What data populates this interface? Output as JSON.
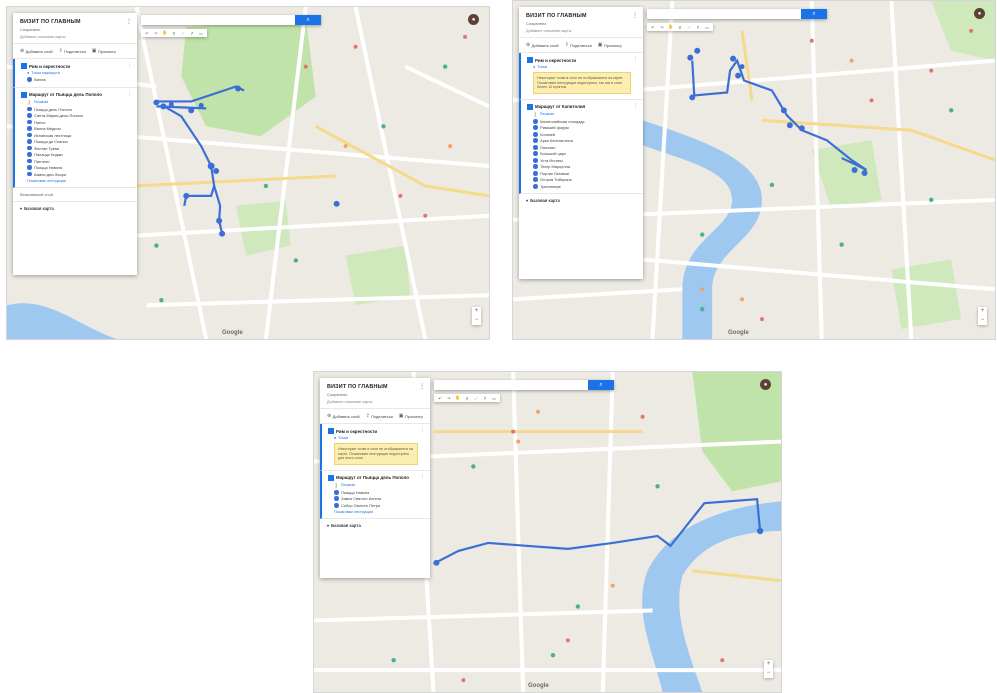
{
  "colors": {
    "route": "#3b6fd6",
    "accent": "#1a73e8",
    "park": "#bfe3a8",
    "water": "#9fc8f0",
    "road": "#ffffff",
    "warning_bg": "#fbeeb0"
  },
  "icons": {
    "search": "search-icon",
    "avatar": "avatar-icon",
    "more": "more-vert-icon",
    "add": "add-icon",
    "share": "share-icon",
    "preview": "preview-icon",
    "layer_check": "checkbox-icon",
    "marker": "marker-icon",
    "zoom_in": "plus-icon",
    "zoom_out": "minus-icon"
  },
  "shots": [
    {
      "panel": {
        "title": "ВИЗИТ ПО ГЛАВНЫМ",
        "subtitle": "Сохранено",
        "description": "Добавьте описание карты",
        "actions": [
          "Добавить слой",
          "Поделиться",
          "Просмотр"
        ],
        "layer1": {
          "name": "Рим и окрестности",
          "sub": "Точки маршрута",
          "items": [
            "Вилла"
          ]
        },
        "layer2": {
          "name": "Маршрут от Пьяцца дель Пополо",
          "sub": "Пешком",
          "items": [
            "Пьяцца дель Пополо",
            "Санта-Мария-дель-Пополо",
            "Пинчо",
            "Вилла Медичи",
            "Испанская лестница",
            "Пьяцца ди Спанья",
            "Фонтан Треви",
            "Палаццо Киджи",
            "Пантеон",
            "Пьяцца Навона",
            "Кампо-деи-Фьори"
          ],
          "link": "Пошаговые инструкции"
        },
        "add_layer": "Безымянный слой",
        "base_map": "Базовая карта"
      }
    },
    {
      "panel": {
        "title": "ВИЗИТ ПО ГЛАВНЫМ",
        "subtitle": "Сохранено",
        "description": "Добавьте описание карты",
        "actions": [
          "Добавить слой",
          "Поделиться",
          "Просмотр"
        ],
        "layer1": {
          "name": "Рим и окрестности",
          "sub": "Точки",
          "warning": "Некоторые точки в слое не отображаются на карте. Пошаговые инструкции недоступны, так как в слое более 10 пунктов."
        },
        "layer2": {
          "name": "Маршрут от Капитолия",
          "sub": "Пешком",
          "items": [
            "Капитолийская площадь",
            "Римский форум",
            "Колизей",
            "Арка Константина",
            "Палатин",
            "Большой цирк",
            "Уста Истины",
            "Театр Марцелла",
            "Портик Октавии",
            "Остров Тиберина",
            "Трастевере"
          ]
        },
        "base_map": "Базовая карта"
      }
    },
    {
      "panel": {
        "title": "ВИЗИТ ПО ГЛАВНЫМ",
        "subtitle": "Сохранено",
        "description": "Добавьте описание карты",
        "actions": [
          "Добавить слой",
          "Поделиться",
          "Просмотр"
        ],
        "layer1": {
          "name": "Рим и окрестности",
          "sub": "Точки",
          "warning": "Некоторые точки в слое не отображаются на карте. Пошаговые инструкции недоступны для этого слоя."
        },
        "layer2": {
          "name": "Маршрут от Пьяцца дель Пополо",
          "sub": "Пешком",
          "items": [
            "Пьяцца Навона",
            "Замок Святого Ангела",
            "Собор Святого Петра"
          ],
          "link": "Пошаговые инструкции"
        },
        "base_map": "Базовая карта"
      }
    }
  ]
}
